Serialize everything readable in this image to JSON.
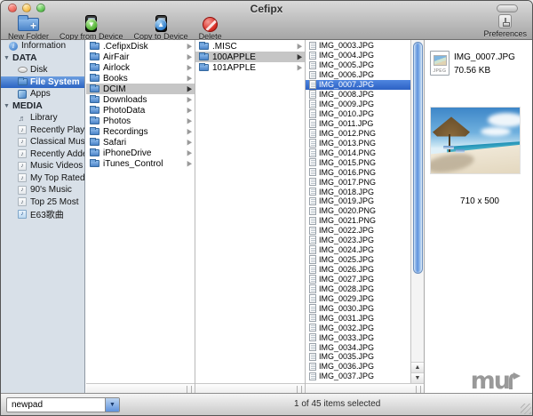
{
  "window": {
    "title": "Cefipx"
  },
  "toolbar": {
    "buttons": [
      {
        "label": "New Folder",
        "icon": "new-folder"
      },
      {
        "label": "Copy from Device",
        "icon": "copy-from-device"
      },
      {
        "label": "Copy to Device",
        "icon": "copy-to-device"
      },
      {
        "label": "Delete",
        "icon": "delete"
      }
    ],
    "preferences_label": "Preferences"
  },
  "sidebar": {
    "information_label": "Information",
    "sections": [
      {
        "label": "DATA",
        "items": [
          {
            "label": "Disk",
            "icon": "disk",
            "selected": false
          },
          {
            "label": "File System",
            "icon": "folder",
            "selected": true
          },
          {
            "label": "Apps",
            "icon": "apps",
            "selected": false
          }
        ]
      },
      {
        "label": "MEDIA",
        "items": [
          {
            "label": "Library",
            "icon": "note",
            "selected": false
          },
          {
            "label": "Recently Played",
            "icon": "playlist",
            "selected": false
          },
          {
            "label": "Classical Music",
            "icon": "playlist",
            "selected": false
          },
          {
            "label": "Recently Added",
            "icon": "playlist",
            "selected": false
          },
          {
            "label": "Music Videos",
            "icon": "playlist",
            "selected": false
          },
          {
            "label": "My Top Rated",
            "icon": "playlist",
            "selected": false
          },
          {
            "label": "90's Music",
            "icon": "playlist",
            "selected": false
          },
          {
            "label": "Top 25 Most",
            "icon": "playlist",
            "selected": false
          },
          {
            "label": "E63歌曲",
            "icon": "song",
            "selected": false
          }
        ]
      }
    ]
  },
  "browser": {
    "column1": [
      {
        "label": ".CefipxDisk",
        "selected": false
      },
      {
        "label": "AirFair",
        "selected": false
      },
      {
        "label": "Airlock",
        "selected": false
      },
      {
        "label": "Books",
        "selected": false
      },
      {
        "label": "DCIM",
        "selected": true
      },
      {
        "label": "Downloads",
        "selected": false
      },
      {
        "label": "PhotoData",
        "selected": false
      },
      {
        "label": "Photos",
        "selected": false
      },
      {
        "label": "Recordings",
        "selected": false
      },
      {
        "label": "Safari",
        "selected": false
      },
      {
        "label": "iPhoneDrive",
        "selected": false
      },
      {
        "label": "iTunes_Control",
        "selected": false
      }
    ],
    "column2": [
      {
        "label": ".MISC",
        "selected": false
      },
      {
        "label": "100APPLE",
        "selected": true
      },
      {
        "label": "101APPLE",
        "selected": false
      }
    ],
    "files": [
      {
        "label": "IMG_0003.JPG",
        "selected": false
      },
      {
        "label": "IMG_0004.JPG",
        "selected": false
      },
      {
        "label": "IMG_0005.JPG",
        "selected": false
      },
      {
        "label": "IMG_0006.JPG",
        "selected": false
      },
      {
        "label": "IMG_0007.JPG",
        "selected": true
      },
      {
        "label": "IMG_0008.JPG",
        "selected": false
      },
      {
        "label": "IMG_0009.JPG",
        "selected": false
      },
      {
        "label": "IMG_0010.JPG",
        "selected": false
      },
      {
        "label": "IMG_0011.JPG",
        "selected": false
      },
      {
        "label": "IMG_0012.PNG",
        "selected": false
      },
      {
        "label": "IMG_0013.PNG",
        "selected": false
      },
      {
        "label": "IMG_0014.PNG",
        "selected": false
      },
      {
        "label": "IMG_0015.PNG",
        "selected": false
      },
      {
        "label": "IMG_0016.PNG",
        "selected": false
      },
      {
        "label": "IMG_0017.PNG",
        "selected": false
      },
      {
        "label": "IMG_0018.JPG",
        "selected": false
      },
      {
        "label": "IMG_0019.JPG",
        "selected": false
      },
      {
        "label": "IMG_0020.PNG",
        "selected": false
      },
      {
        "label": "IMG_0021.PNG",
        "selected": false
      },
      {
        "label": "IMG_0022.JPG",
        "selected": false
      },
      {
        "label": "IMG_0023.JPG",
        "selected": false
      },
      {
        "label": "IMG_0024.JPG",
        "selected": false
      },
      {
        "label": "IMG_0025.JPG",
        "selected": false
      },
      {
        "label": "IMG_0026.JPG",
        "selected": false
      },
      {
        "label": "IMG_0027.JPG",
        "selected": false
      },
      {
        "label": "IMG_0028.JPG",
        "selected": false
      },
      {
        "label": "IMG_0029.JPG",
        "selected": false
      },
      {
        "label": "IMG_0030.JPG",
        "selected": false
      },
      {
        "label": "IMG_0031.JPG",
        "selected": false
      },
      {
        "label": "IMG_0032.JPG",
        "selected": false
      },
      {
        "label": "IMG_0033.JPG",
        "selected": false
      },
      {
        "label": "IMG_0034.JPG",
        "selected": false
      },
      {
        "label": "IMG_0035.JPG",
        "selected": false
      },
      {
        "label": "IMG_0036.JPG",
        "selected": false
      },
      {
        "label": "IMG_0037.JPG",
        "selected": false
      }
    ]
  },
  "preview": {
    "filename": "IMG_0007.JPG",
    "filesize": "70.56 KB",
    "dimensions": "710 x 500",
    "icon_label": "JPEG"
  },
  "statusbar": {
    "device_selector": "newpad",
    "status": "1 of 45 items selected"
  },
  "watermark": {
    "text": "mu"
  },
  "colors": {
    "selection_blue": "#3875d7",
    "selection_gray": "#c6c6c6",
    "sidebar_bg": "#d8e0e8"
  }
}
